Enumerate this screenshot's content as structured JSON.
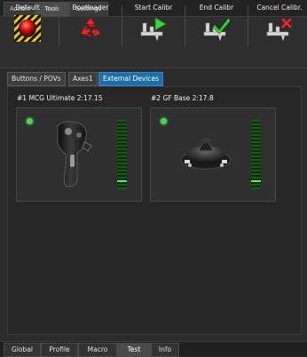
{
  "top_tabs": [
    "Action",
    "Tools",
    "Settings"
  ],
  "active_top_tab": "Tools",
  "ribbon": {
    "default_label": "Default",
    "bootloader_label": "Bootloader",
    "start_calibr_label": "Start Calibr",
    "end_calibr_label": "End Calibr",
    "cancel_calibr_label": "Cancel Calibr."
  },
  "sub_tabs": [
    "Buttons / POVs",
    "Axes1",
    "External Devices"
  ],
  "active_sub_tab": "External Devices",
  "devices": [
    {
      "title": "#1 MCG Ultimate 2:17.15",
      "status_color": "#4cd84c",
      "level": 0.02
    },
    {
      "title": "#2 GF Base 2:17.8",
      "status_color": "#4cd84c",
      "level": 0.02
    }
  ],
  "bottom_tabs": [
    "Global",
    "Profile",
    "Macro",
    "Test",
    "Info"
  ],
  "active_bottom_tab": "Test",
  "icons": {
    "default": "warning-red-button-icon",
    "bootloader": "red-recycle-icon",
    "start_calibr": "calipers-play-icon",
    "end_calibr": "calipers-check-icon",
    "cancel_calibr": "calipers-cross-icon"
  },
  "colors": {
    "accent": "#1e6fa8",
    "led": "#4cd84c",
    "meter": "#5ef05e",
    "cancel": "#e02b2b",
    "check": "#3fd23f"
  }
}
